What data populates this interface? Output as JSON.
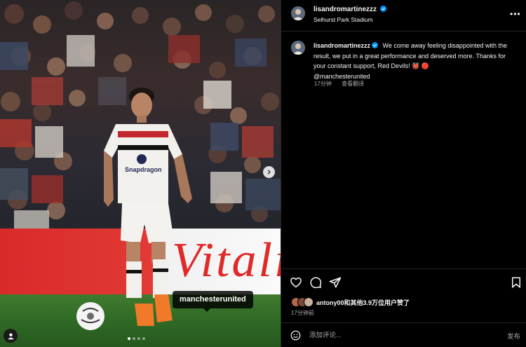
{
  "post": {
    "username": "lisandromartinezzz",
    "location": "Selhurst Park Stadium",
    "caption_text": "We come away feeling disappointed with the result, we put in a great performance and deserved more. Thanks for your constant support, Red Devils! 👹 🔴",
    "caption_mention": "@manchesterunited",
    "time_ago": "17分钟",
    "translate_label": "查看翻译"
  },
  "media": {
    "tag_label": "manchesterunited",
    "sponsor_text": "Snapdragon",
    "board_text": "Vitali",
    "carousel_dots": 4,
    "active_dot": 0
  },
  "engagement": {
    "likes_text": "antony00和其他3.9万位用户赞了",
    "post_time": "17分钟前"
  },
  "comment": {
    "placeholder": "添加评论...",
    "post_label": "发布"
  },
  "colors": {
    "verified_blue": "#0095f6",
    "background": "#000000",
    "divider": "#262626",
    "secondary_text": "#a8a8a8"
  },
  "icons": {
    "more": "more-options-icon",
    "like": "heart-icon",
    "comment": "comment-icon",
    "share": "share-icon",
    "save": "bookmark-icon",
    "emoji": "emoji-icon",
    "next": "chevron-right-icon",
    "user_tag": "user-tag-icon"
  }
}
